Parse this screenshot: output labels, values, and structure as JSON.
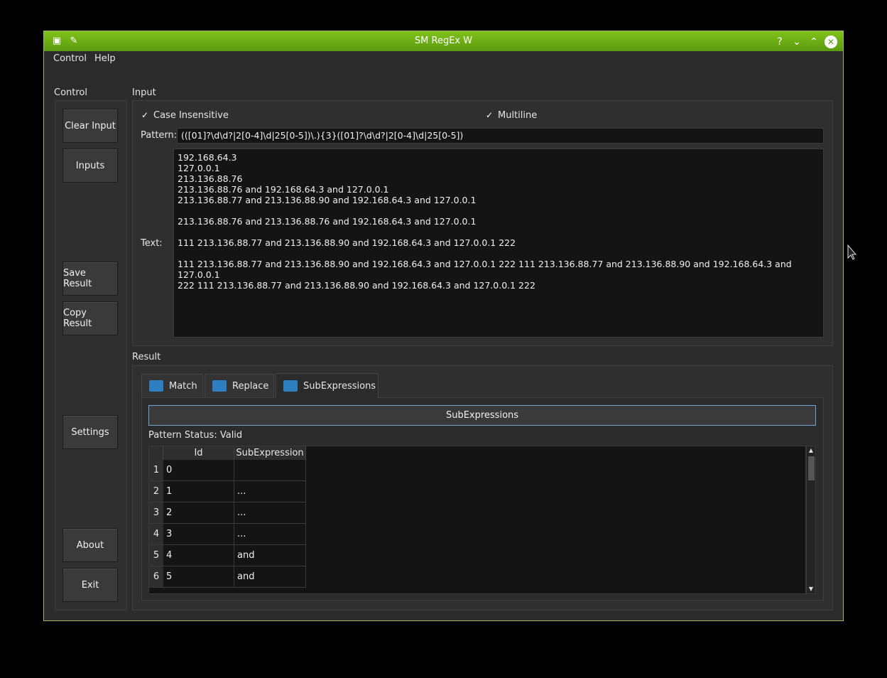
{
  "window": {
    "title": "SM RegEx W",
    "accent": "#6aae14"
  },
  "titlebar_buttons": [
    "help-icon",
    "minimize-icon",
    "maximize-icon",
    "close-icon"
  ],
  "menu": [
    "Control",
    "Help"
  ],
  "control_group": {
    "title": "Control",
    "buttons": [
      "Clear Input",
      "Inputs",
      "Save Result",
      "Copy Result",
      "Settings",
      "About",
      "Exit"
    ]
  },
  "input_group": {
    "title": "Input",
    "case_insensitive": {
      "label": "Case Insensitive",
      "checked": true
    },
    "multiline": {
      "label": "Multiline",
      "checked": true
    },
    "pattern_label": "Pattern:",
    "pattern_value": "(([01]?\\d\\d?|2[0-4]\\d|25[0-5])\\.){3}([01]?\\d\\d?|2[0-4]\\d|25[0-5])",
    "text_label": "Text:",
    "text_value": "192.168.64.3\n127.0.0.1\n213.136.88.76\n213.136.88.76 and 192.168.64.3 and 127.0.0.1\n213.136.88.77 and 213.136.88.90 and 192.168.64.3 and 127.0.0.1\n\n213.136.88.76 and 213.136.88.76 and 192.168.64.3 and 127.0.0.1\n\n111 213.136.88.77 and 213.136.88.90 and 192.168.64.3 and 127.0.0.1 222\n\n111 213.136.88.77 and 213.136.88.90 and 192.168.64.3 and 127.0.0.1 222 111 213.136.88.77 and 213.136.88.90 and 192.168.64.3 and 127.0.0.1\n222 111 213.136.88.77 and 213.136.88.90 and 192.168.64.3 and 127.0.0.1 222"
  },
  "result_group": {
    "title": "Result",
    "tabs": [
      "Match",
      "Replace",
      "SubExpressions"
    ],
    "active_tab": "SubExpressions",
    "action_button": "SubExpressions",
    "status": "Pattern Status: Valid",
    "columns": [
      "Id",
      "SubExpression"
    ],
    "rows": [
      {
        "n": "1",
        "id": "0",
        "sub": ""
      },
      {
        "n": "2",
        "id": "1",
        "sub": "..."
      },
      {
        "n": "3",
        "id": "2",
        "sub": "..."
      },
      {
        "n": "4",
        "id": "3",
        "sub": " ..."
      },
      {
        "n": "5",
        "id": "4",
        "sub": " and"
      },
      {
        "n": "6",
        "id": "5",
        "sub": " and"
      }
    ]
  }
}
